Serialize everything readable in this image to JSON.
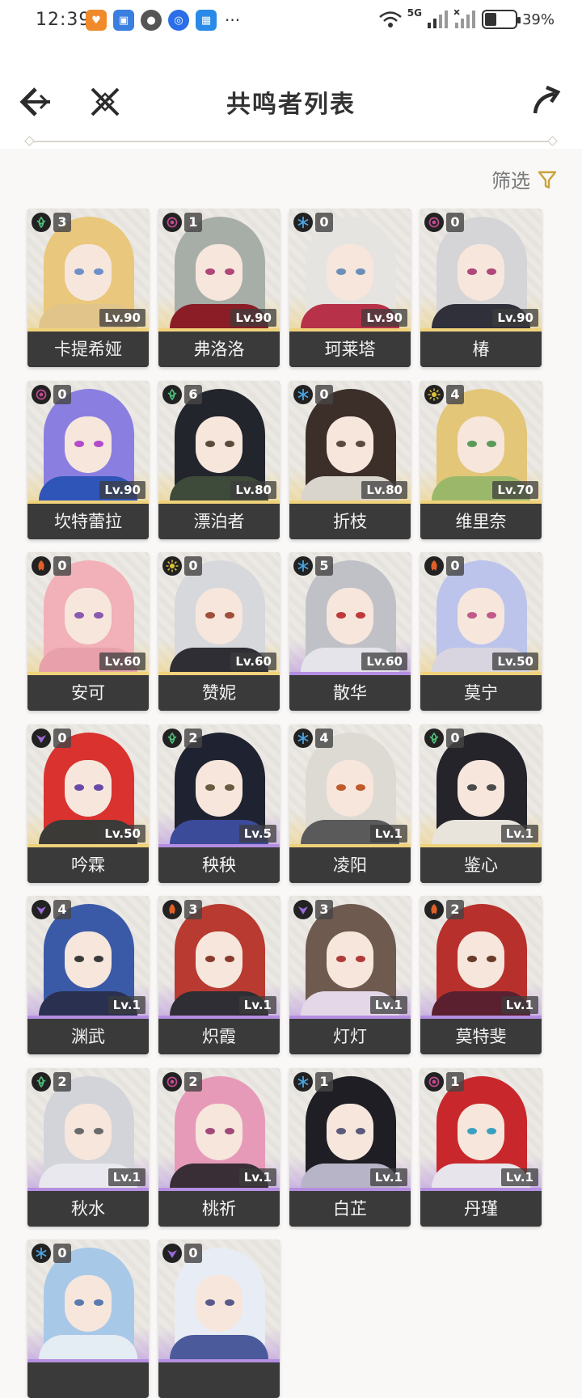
{
  "status_bar": {
    "time": "12:39",
    "network": "5G",
    "battery": "39%"
  },
  "header": {
    "title": "共鸣者列表",
    "back_icon": "back-arrow-icon",
    "cross_icon": "crossed-swords-icon",
    "share_icon": "share-icon"
  },
  "filter": {
    "label": "筛选",
    "icon": "filter-funnel-icon",
    "accent": "#c9a33a"
  },
  "elements": {
    "aero": "#4fbf7a",
    "havoc": "#c04a8f",
    "glacio": "#4aa3e0",
    "fusion": "#e0602a",
    "spectro": "#d9c23a",
    "electro": "#9a6ad9"
  },
  "rarity_colors": {
    "five_star": "#f0d27a",
    "four_star": "#b48ee0"
  },
  "characters": [
    {
      "name": "卡提希娅",
      "level": "Lv.90",
      "chain": "3",
      "element": "aero",
      "rarity": "five_star",
      "hair": "#e9c77c",
      "outfit": "#e0c48a",
      "eye": "#6f8fc9"
    },
    {
      "name": "弗洛洛",
      "level": "Lv.90",
      "chain": "1",
      "element": "havoc",
      "rarity": "five_star",
      "hair": "#a7aea8",
      "outfit": "#8a1d25",
      "eye": "#b0467a"
    },
    {
      "name": "珂莱塔",
      "level": "Lv.90",
      "chain": "0",
      "element": "glacio",
      "rarity": "five_star",
      "hair": "#e6e4e0",
      "outfit": "#b73248",
      "eye": "#6b8fb8"
    },
    {
      "name": "椿",
      "level": "Lv.90",
      "chain": "0",
      "element": "havoc",
      "rarity": "five_star",
      "hair": "#d5d5d8",
      "outfit": "#30303a",
      "eye": "#b0467a"
    },
    {
      "name": "坎特蕾拉",
      "level": "Lv.90",
      "chain": "0",
      "element": "havoc",
      "rarity": "five_star",
      "hair": "#8a7fe0",
      "outfit": "#2f55b8",
      "eye": "#b44acc"
    },
    {
      "name": "漂泊者",
      "level": "Lv.80",
      "chain": "6",
      "element": "aero",
      "rarity": "five_star",
      "hair": "#23252d",
      "outfit": "#3e4a3a",
      "eye": "#5a4b3a"
    },
    {
      "name": "折枝",
      "level": "Lv.80",
      "chain": "0",
      "element": "glacio",
      "rarity": "five_star",
      "hair": "#3c2f2a",
      "outfit": "#d9d4cc",
      "eye": "#5b4a40"
    },
    {
      "name": "维里奈",
      "level": "Lv.70",
      "chain": "4",
      "element": "spectro",
      "rarity": "five_star",
      "hair": "#e3c678",
      "outfit": "#9bb86a",
      "eye": "#5a9a5a"
    },
    {
      "name": "安可",
      "level": "Lv.60",
      "chain": "0",
      "element": "fusion",
      "rarity": "five_star",
      "hair": "#f2b0b8",
      "outfit": "#e8a0aa",
      "eye": "#8a5ab0"
    },
    {
      "name": "赞妮",
      "level": "Lv.60",
      "chain": "0",
      "element": "spectro",
      "rarity": "five_star",
      "hair": "#d6d8dc",
      "outfit": "#2e2e34",
      "eye": "#a0503a"
    },
    {
      "name": "散华",
      "level": "Lv.60",
      "chain": "5",
      "element": "glacio",
      "rarity": "four_star",
      "hair": "#bfc1c7",
      "outfit": "#e4e4ea",
      "eye": "#c03a3a"
    },
    {
      "name": "莫宁",
      "level": "Lv.50",
      "chain": "0",
      "element": "fusion",
      "rarity": "five_star",
      "hair": "#bcc4ec",
      "outfit": "#d8d4e0",
      "eye": "#c05a8a"
    },
    {
      "name": "吟霖",
      "level": "Lv.50",
      "chain": "0",
      "element": "electro",
      "rarity": "five_star",
      "hair": "#d9322f",
      "outfit": "#3c3a36",
      "eye": "#6a4aa8"
    },
    {
      "name": "秧秧",
      "level": "Lv.5",
      "chain": "2",
      "element": "aero",
      "rarity": "four_star",
      "hair": "#1f2230",
      "outfit": "#3c4a9a",
      "eye": "#6a5a40"
    },
    {
      "name": "凌阳",
      "level": "Lv.1",
      "chain": "4",
      "element": "glacio",
      "rarity": "five_star",
      "hair": "#dcdad2",
      "outfit": "#5a5a5a",
      "eye": "#c05a2a"
    },
    {
      "name": "鉴心",
      "level": "Lv.1",
      "chain": "0",
      "element": "aero",
      "rarity": "five_star",
      "hair": "#24242a",
      "outfit": "#e8e4dc",
      "eye": "#4a4a4a"
    },
    {
      "name": "渊武",
      "level": "Lv.1",
      "chain": "4",
      "element": "electro",
      "rarity": "four_star",
      "hair": "#3a5aa8",
      "outfit": "#2a3050",
      "eye": "#3a3a3a"
    },
    {
      "name": "炽霞",
      "level": "Lv.1",
      "chain": "3",
      "element": "fusion",
      "rarity": "four_star",
      "hair": "#b83a30",
      "outfit": "#2e2e34",
      "eye": "#8a3a2a"
    },
    {
      "name": "灯灯",
      "level": "Lv.1",
      "chain": "3",
      "element": "electro",
      "rarity": "four_star",
      "hair": "#6e5a4e",
      "outfit": "#e4d8e8",
      "eye": "#b03a3a"
    },
    {
      "name": "莫特斐",
      "level": "Lv.1",
      "chain": "2",
      "element": "fusion",
      "rarity": "four_star",
      "hair": "#b8302c",
      "outfit": "#5a2030",
      "eye": "#6a3a2a"
    },
    {
      "name": "秋水",
      "level": "Lv.1",
      "chain": "2",
      "element": "aero",
      "rarity": "four_star",
      "hair": "#d2d4da",
      "outfit": "#e8e8ee",
      "eye": "#6a6a6a"
    },
    {
      "name": "桃祈",
      "level": "Lv.1",
      "chain": "2",
      "element": "havoc",
      "rarity": "four_star",
      "hair": "#e69ab8",
      "outfit": "#3a2e36",
      "eye": "#a04a7a"
    },
    {
      "name": "白芷",
      "level": "Lv.1",
      "chain": "1",
      "element": "glacio",
      "rarity": "four_star",
      "hair": "#1e1e24",
      "outfit": "#b8b4c8",
      "eye": "#5a5a7a"
    },
    {
      "name": "丹瑾",
      "level": "Lv.1",
      "chain": "1",
      "element": "havoc",
      "rarity": "four_star",
      "hair": "#c8282c",
      "outfit": "#e8e4ec",
      "eye": "#3aa0c0"
    },
    {
      "name": "",
      "level": "",
      "chain": "0",
      "element": "glacio",
      "rarity": "four_star",
      "hair": "#a8c8e8",
      "outfit": "#e4ecf4",
      "eye": "#5a7ab0"
    },
    {
      "name": "",
      "level": "",
      "chain": "0",
      "element": "electro",
      "rarity": "four_star",
      "hair": "#e8ecf4",
      "outfit": "#4a5a9a",
      "eye": "#5a5a8a"
    }
  ]
}
